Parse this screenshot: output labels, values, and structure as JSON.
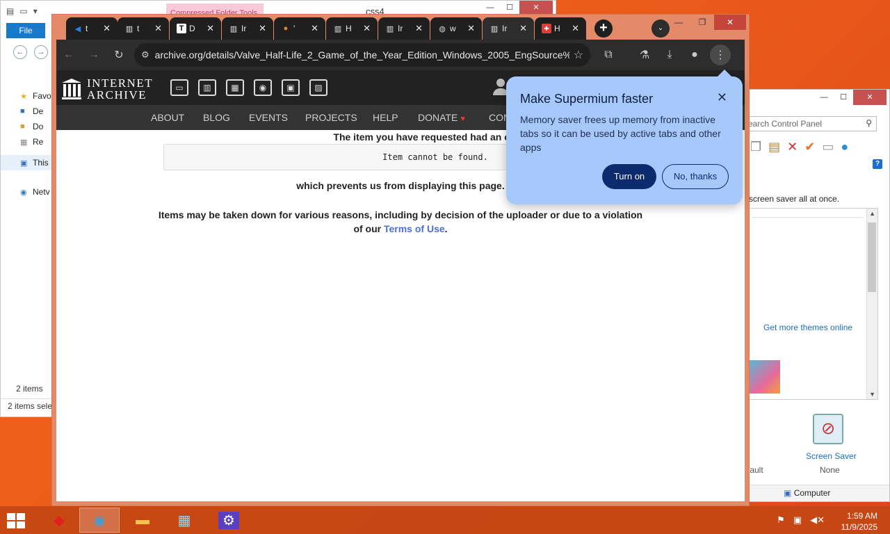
{
  "explorer": {
    "context_tab": "Compressed Folder Tools",
    "title": "css4",
    "file_tab": "File",
    "sidebar": [
      "Favo",
      "De",
      "Do",
      "Re",
      "This",
      "Netv"
    ],
    "status_items": "2 items",
    "status_selected": "2 items sele"
  },
  "cpanel": {
    "search_placeholder": "earch Control Panel",
    "desc": "screen saver all at once.",
    "themes_link": "Get more themes online",
    "default_label": "fault",
    "screen_saver_label": "Screen Saver",
    "screen_saver_value": "None",
    "status": "Computer"
  },
  "browser": {
    "tabs": [
      {
        "title": "t",
        "icon": "blue-arrow-icon",
        "color": "#2a7de1"
      },
      {
        "title": "t",
        "icon": "internet-archive-icon",
        "color": "#e8e8e8"
      },
      {
        "title": "D",
        "icon": "t-logo-icon",
        "color": "#ffffff"
      },
      {
        "title": "Ir",
        "icon": "internet-archive-icon",
        "color": "#e8e8e8"
      },
      {
        "title": "'",
        "icon": "orange-shield-icon",
        "color": "#e88a2a"
      },
      {
        "title": "H",
        "icon": "internet-archive-icon",
        "color": "#e8e8e8"
      },
      {
        "title": "Ir",
        "icon": "internet-archive-icon",
        "color": "#e8e8e8"
      },
      {
        "title": "w",
        "icon": "globe-icon",
        "color": "#cfcfcf"
      },
      {
        "title": "Ir",
        "icon": "internet-archive-icon",
        "color": "#e8e8e8"
      },
      {
        "title": "H",
        "icon": "red-grid-icon",
        "color": "#e03b3b"
      }
    ],
    "url": "archive.org/details/Valve_Half-Life_2_Game_of_the_Year_Edition_Windows_2005_EngSource%..."
  },
  "archive": {
    "logo_line1": "INTERNET",
    "logo_line2": "ARCHIVE",
    "nav": [
      "ABOUT",
      "BLOG",
      "EVENTS",
      "PROJECTS",
      "HELP",
      "DONATE",
      "CON"
    ],
    "error_heading": "The item you have requested had an error:",
    "error_message": "Item cannot be found.",
    "prevents": "which prevents us from displaying this page.",
    "reasons": "Items may be taken down for various reasons, including by decision of the uploader or due to a violation of our",
    "terms_link": "Terms of Use",
    "terms_suffix": "."
  },
  "bubble": {
    "title": "Make Supermium faster",
    "body": "Memory saver frees up memory from inactive tabs so it can be used by active tabs and other apps",
    "turn_on": "Turn on",
    "no_thanks": "No, thanks"
  },
  "taskbar": {
    "time": "1:59 AM",
    "date": "11/9/2025"
  }
}
